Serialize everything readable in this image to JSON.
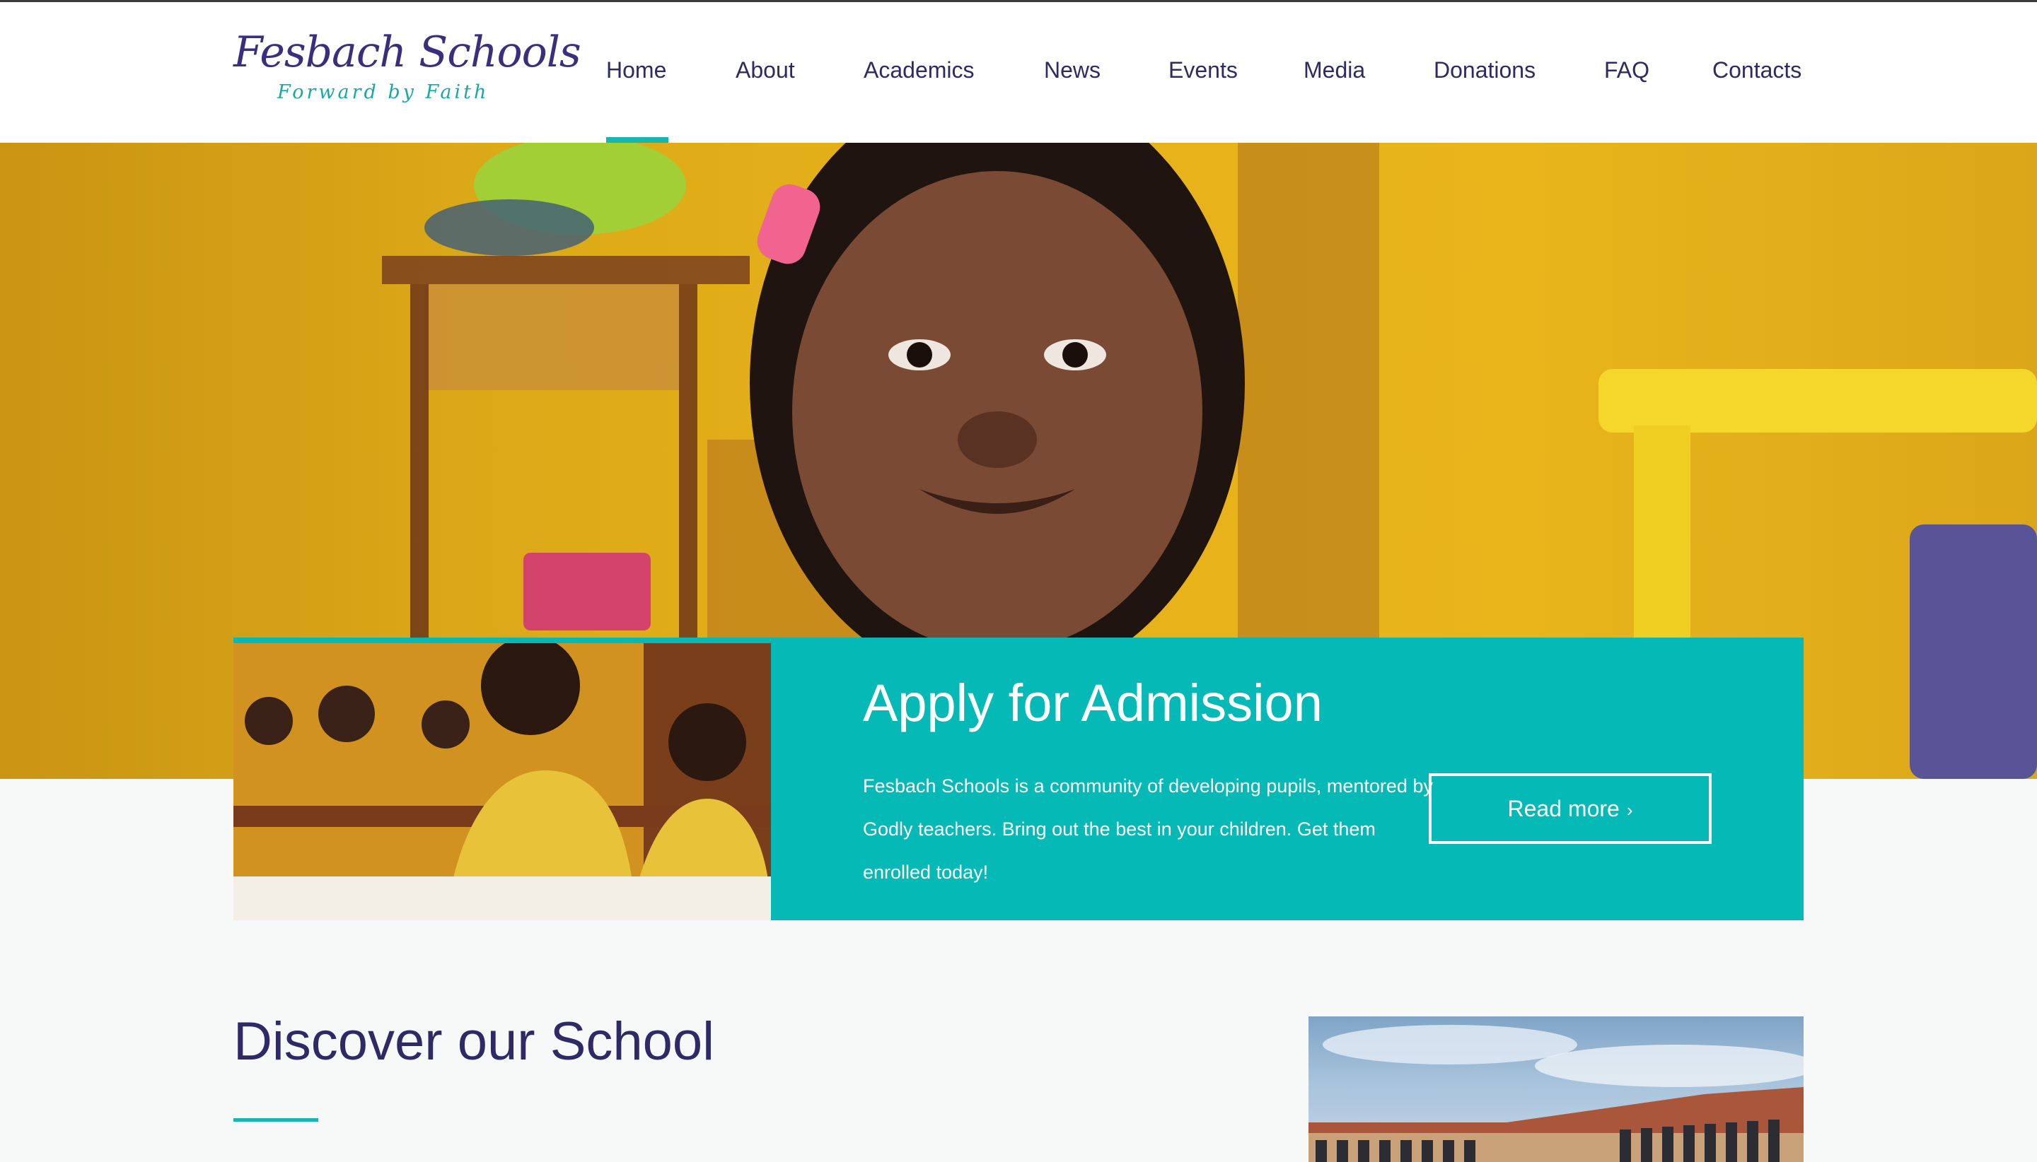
{
  "brand": {
    "name": "Fesbach Schools",
    "tagline": "Forward by Faith"
  },
  "nav": {
    "items": [
      {
        "label": "Home",
        "active": true
      },
      {
        "label": "About"
      },
      {
        "label": "Academics"
      },
      {
        "label": "News"
      },
      {
        "label": "Events"
      },
      {
        "label": "Media"
      },
      {
        "label": "Donations"
      },
      {
        "label": "FAQ"
      },
      {
        "label": "Contacts"
      }
    ]
  },
  "admission": {
    "title": "Apply for Admission",
    "text": "Fesbach Schools is a community of developing pupils, mentored by Godly teachers. Bring out the best in your children. Get them enrolled today!",
    "button_label": "Read more",
    "button_icon": "chevron-right-icon"
  },
  "discover": {
    "title": "Discover our School"
  },
  "colors": {
    "accent": "#05bab6",
    "heading": "#2e2a66",
    "hero_yellow": "#e7b21a"
  }
}
